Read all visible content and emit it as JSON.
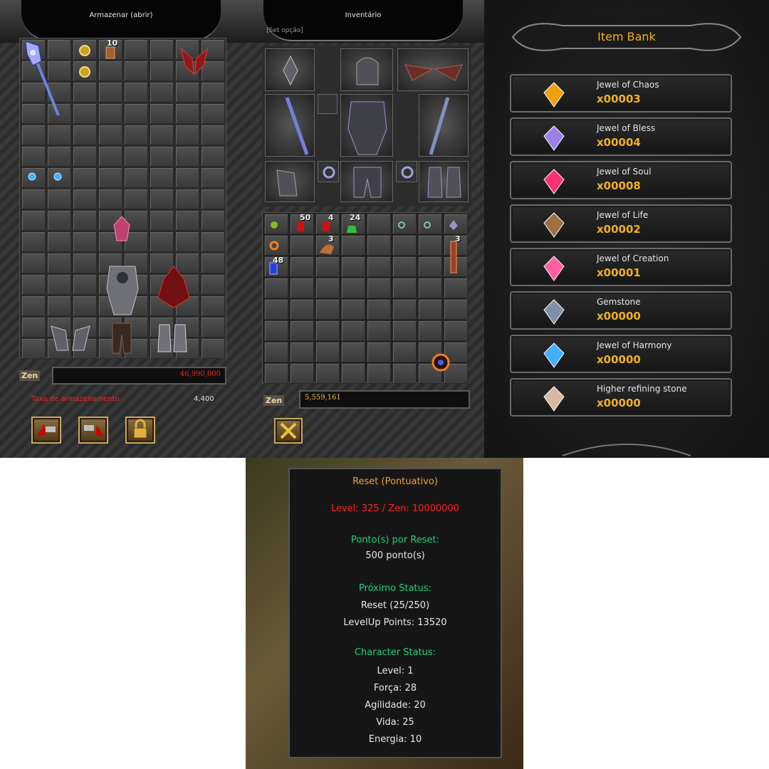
{
  "storage": {
    "title": "Armazenar (abrir)",
    "stack_counts": {
      "small_box": "10"
    },
    "zen_label": "Zen",
    "zen_value": "46,990,000",
    "fee_label": "Taxa de armazenamento",
    "fee_value": "4,400"
  },
  "inventory": {
    "title": "Inventário",
    "subtitle": "[Set opção]",
    "stack_counts": {
      "potion_a": "50",
      "potion_b": "4",
      "potion_c": "24",
      "potion_d": "3",
      "potion_e": "48",
      "jewel_stack": "3"
    },
    "zen_label": "Zen",
    "zen_value": "5,559,161"
  },
  "item_bank": {
    "title": "Item Bank",
    "items": [
      {
        "name": "Jewel of Chaos",
        "qty": "x00003",
        "icon": "jewel-of-chaos-icon",
        "color": "#f0a010"
      },
      {
        "name": "Jewel of Bless",
        "qty": "x00004",
        "icon": "jewel-of-bless-icon",
        "color": "#9a80e8"
      },
      {
        "name": "Jewel of Soul",
        "qty": "x00008",
        "icon": "jewel-of-soul-icon",
        "color": "#ff3070"
      },
      {
        "name": "Jewel of Life",
        "qty": "x00002",
        "icon": "jewel-of-life-icon",
        "color": "#a07040"
      },
      {
        "name": "Jewel of Creation",
        "qty": "x00001",
        "icon": "jewel-of-creation-icon",
        "color": "#ff60a0"
      },
      {
        "name": "Gemstone",
        "qty": "x00000",
        "icon": "gemstone-icon",
        "color": "#8090a8"
      },
      {
        "name": "Jewel of Harmony",
        "qty": "x00000",
        "icon": "jewel-of-harmony-icon",
        "color": "#40b0ff"
      },
      {
        "name": "Higher refining stone",
        "qty": "x00000",
        "icon": "higher-refining-stone-icon",
        "color": "#d8b8a0"
      }
    ]
  },
  "reset": {
    "title": "Reset (Pontuativo)",
    "requirement": "Level: 325 / Zen: 10000000",
    "points_header": "Ponto(s) por Reset:",
    "points_value": "500 ponto(s)",
    "next_header": "Próximo Status:",
    "next_reset": "Reset (25/250)",
    "next_levelup": "LevelUp Points: 13520",
    "char_header": "Character Status:",
    "level": "Level: 1",
    "forca": "Força: 28",
    "agilidade": "Agilidade: 20",
    "vida": "Vida: 25",
    "energia": "Energia: 10"
  },
  "colors": {
    "accent_gold": "#f0b020",
    "requirement_red": "#ff2020",
    "header_green": "#20d080",
    "title_orange": "#f0a030"
  }
}
